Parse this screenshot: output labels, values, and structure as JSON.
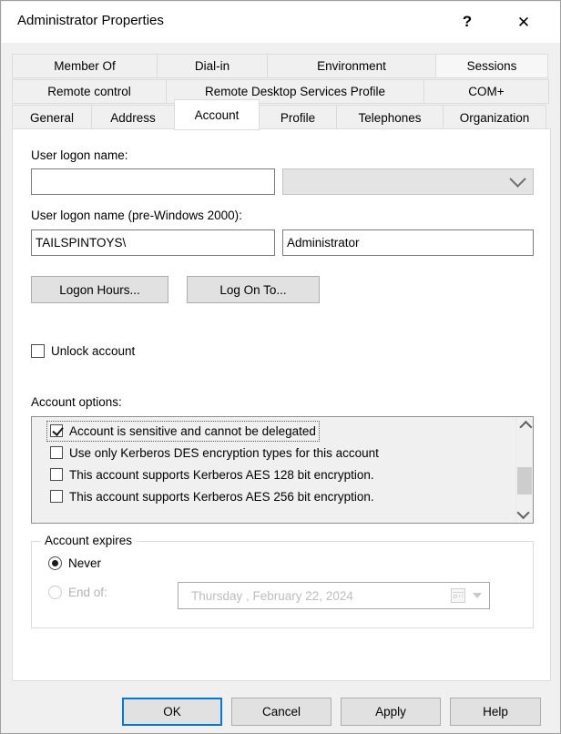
{
  "window": {
    "title": "Administrator Properties",
    "help_button": "?",
    "close_button": "✕"
  },
  "tabs": {
    "row1": [
      {
        "label": "Member Of",
        "state": "normal"
      },
      {
        "label": "Dial-in",
        "state": "normal"
      },
      {
        "label": "Environment",
        "state": "normal"
      },
      {
        "label": "Sessions",
        "state": "hovered"
      }
    ],
    "row2": [
      {
        "label": "Remote control",
        "state": "normal"
      },
      {
        "label": "Remote Desktop Services Profile",
        "state": "normal"
      },
      {
        "label": "COM+",
        "state": "normal"
      }
    ],
    "row3": [
      {
        "label": "General",
        "state": "normal"
      },
      {
        "label": "Address",
        "state": "normal"
      },
      {
        "label": "Account",
        "state": "selected"
      },
      {
        "label": "Profile",
        "state": "normal"
      },
      {
        "label": "Telephones",
        "state": "normal"
      },
      {
        "label": "Organization",
        "state": "normal"
      }
    ]
  },
  "account": {
    "logon_name_label": "User logon name:",
    "logon_name_value": "",
    "logon_name_placeholder": "",
    "upn_suffix_value": "",
    "pre2000_label": "User logon name (pre-Windows 2000):",
    "pre2000_domain": "TAILSPINTOYS\\",
    "pre2000_user": "Administrator",
    "logon_hours_button": "Logon Hours...",
    "log_on_to_button": "Log On To...",
    "unlock_account_label": "Unlock account",
    "unlock_account_checked": false,
    "options_label": "Account options:",
    "options": [
      {
        "label": "Account is sensitive and cannot be delegated",
        "checked": true,
        "focused": true
      },
      {
        "label": "Use only Kerberos DES encryption types for this account",
        "checked": false,
        "focused": false
      },
      {
        "label": "This account supports Kerberos AES 128 bit encryption.",
        "checked": false,
        "focused": false
      },
      {
        "label": "This account supports Kerberos AES 256 bit encryption.",
        "checked": false,
        "focused": false
      }
    ],
    "expires": {
      "group_title": "Account expires",
      "never_label": "Never",
      "never_selected": true,
      "end_of_label": "End of:",
      "end_of_selected": false,
      "end_of_enabled": false,
      "date_value": "Thursday   ,   February  22, 2024"
    }
  },
  "footer": {
    "ok": "OK",
    "cancel": "Cancel",
    "apply": "Apply",
    "help": "Help"
  },
  "colors": {
    "accent": "#0078d7",
    "dialog_bg": "#f0f0f0",
    "panel_bg": "#ffffff",
    "listbox_bg": "#f0f0f0",
    "scroll_thumb": "#cdcdcd"
  }
}
